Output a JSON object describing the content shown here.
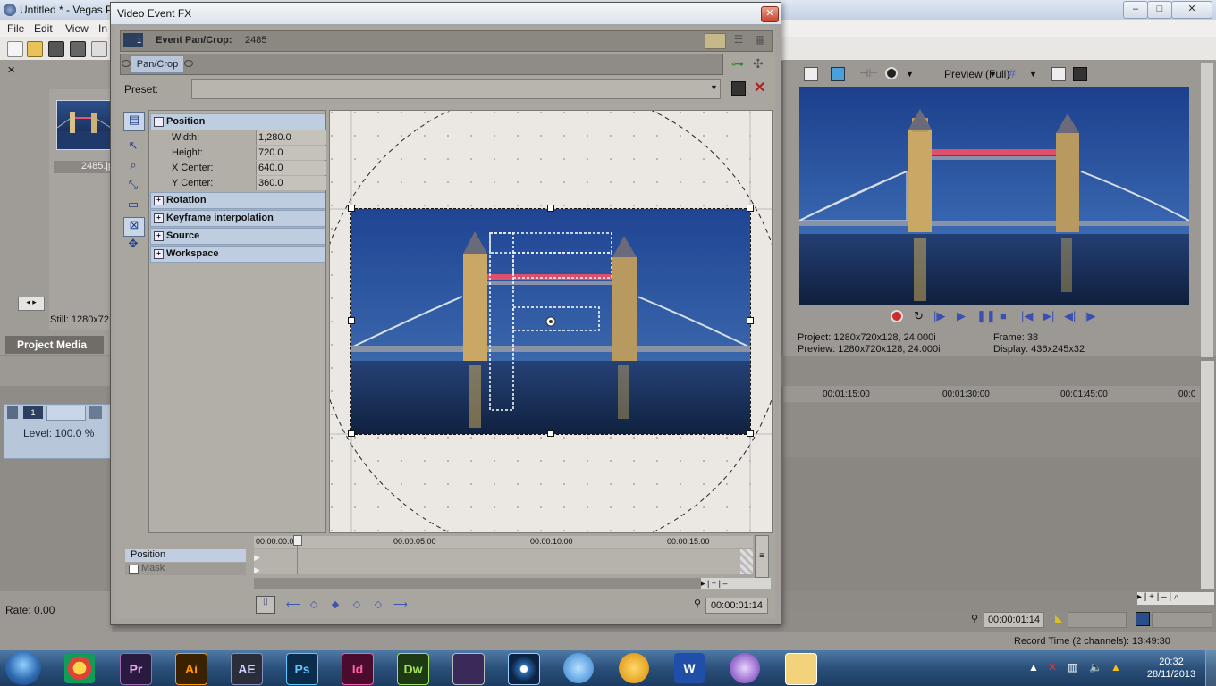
{
  "main_window": {
    "title": "Untitled * - Vegas P",
    "controls": {
      "minimize": "–",
      "maximize": "□",
      "close": "✕"
    },
    "menu": [
      "File",
      "Edit",
      "View",
      "In"
    ],
    "left": {
      "media_label": "2485.jp",
      "still_info": "Still: 1280x72",
      "project_media_tab": "Project Media",
      "track_level": "Level: 100.0 %",
      "rate": "Rate: 0.00"
    },
    "preview": {
      "mode_label": "Preview (Full)",
      "project_info": "Project:  1280x720x128, 24.000i",
      "preview_info": "Preview:  1280x720x128, 24.000i",
      "frame_info": "Frame:      38",
      "display_info": "Display:    436x245x32"
    },
    "timeline": {
      "ruler_labels": [
        "00:01:15:00",
        "00:01:30:00",
        "00:01:45:00",
        "00:0"
      ],
      "current_time": "00:00:01:14",
      "record_time": "Record Time (2 channels): 13:49:30"
    }
  },
  "fx_dialog": {
    "title": "Video Event FX",
    "close": "✕",
    "event_label": "Event Pan/Crop:",
    "event_value": "2485",
    "chain_chip": "Pan/Crop",
    "preset_label": "Preset:",
    "preset_value": "",
    "properties": {
      "position": {
        "label": "Position",
        "rows": [
          {
            "key": "Width:",
            "value": "1,280.0"
          },
          {
            "key": "Height:",
            "value": "720.0"
          },
          {
            "key": "X Center:",
            "value": "640.0"
          },
          {
            "key": "Y Center:",
            "value": "360.0"
          }
        ]
      },
      "collapsed_groups": [
        "Rotation",
        "Keyframe interpolation",
        "Source",
        "Workspace"
      ]
    },
    "keyframes": {
      "position_label": "Position",
      "mask_label": "Mask",
      "ruler_labels": [
        "00:00:00:00",
        "00:00:05:00",
        "00:00:10:00",
        "00:00:15:00"
      ],
      "cursor_time": "00:00:01:14"
    }
  },
  "taskbar": {
    "apps": [
      "Pr",
      "Ai",
      "AE",
      "Ps",
      "Id",
      "Dw"
    ],
    "clock_time": "20:32",
    "clock_date": "28/11/2013"
  },
  "colors": {
    "accent": "#2f6bb2",
    "panel_gray": "#a9a59f",
    "selection_blue": "#bfcde0"
  }
}
